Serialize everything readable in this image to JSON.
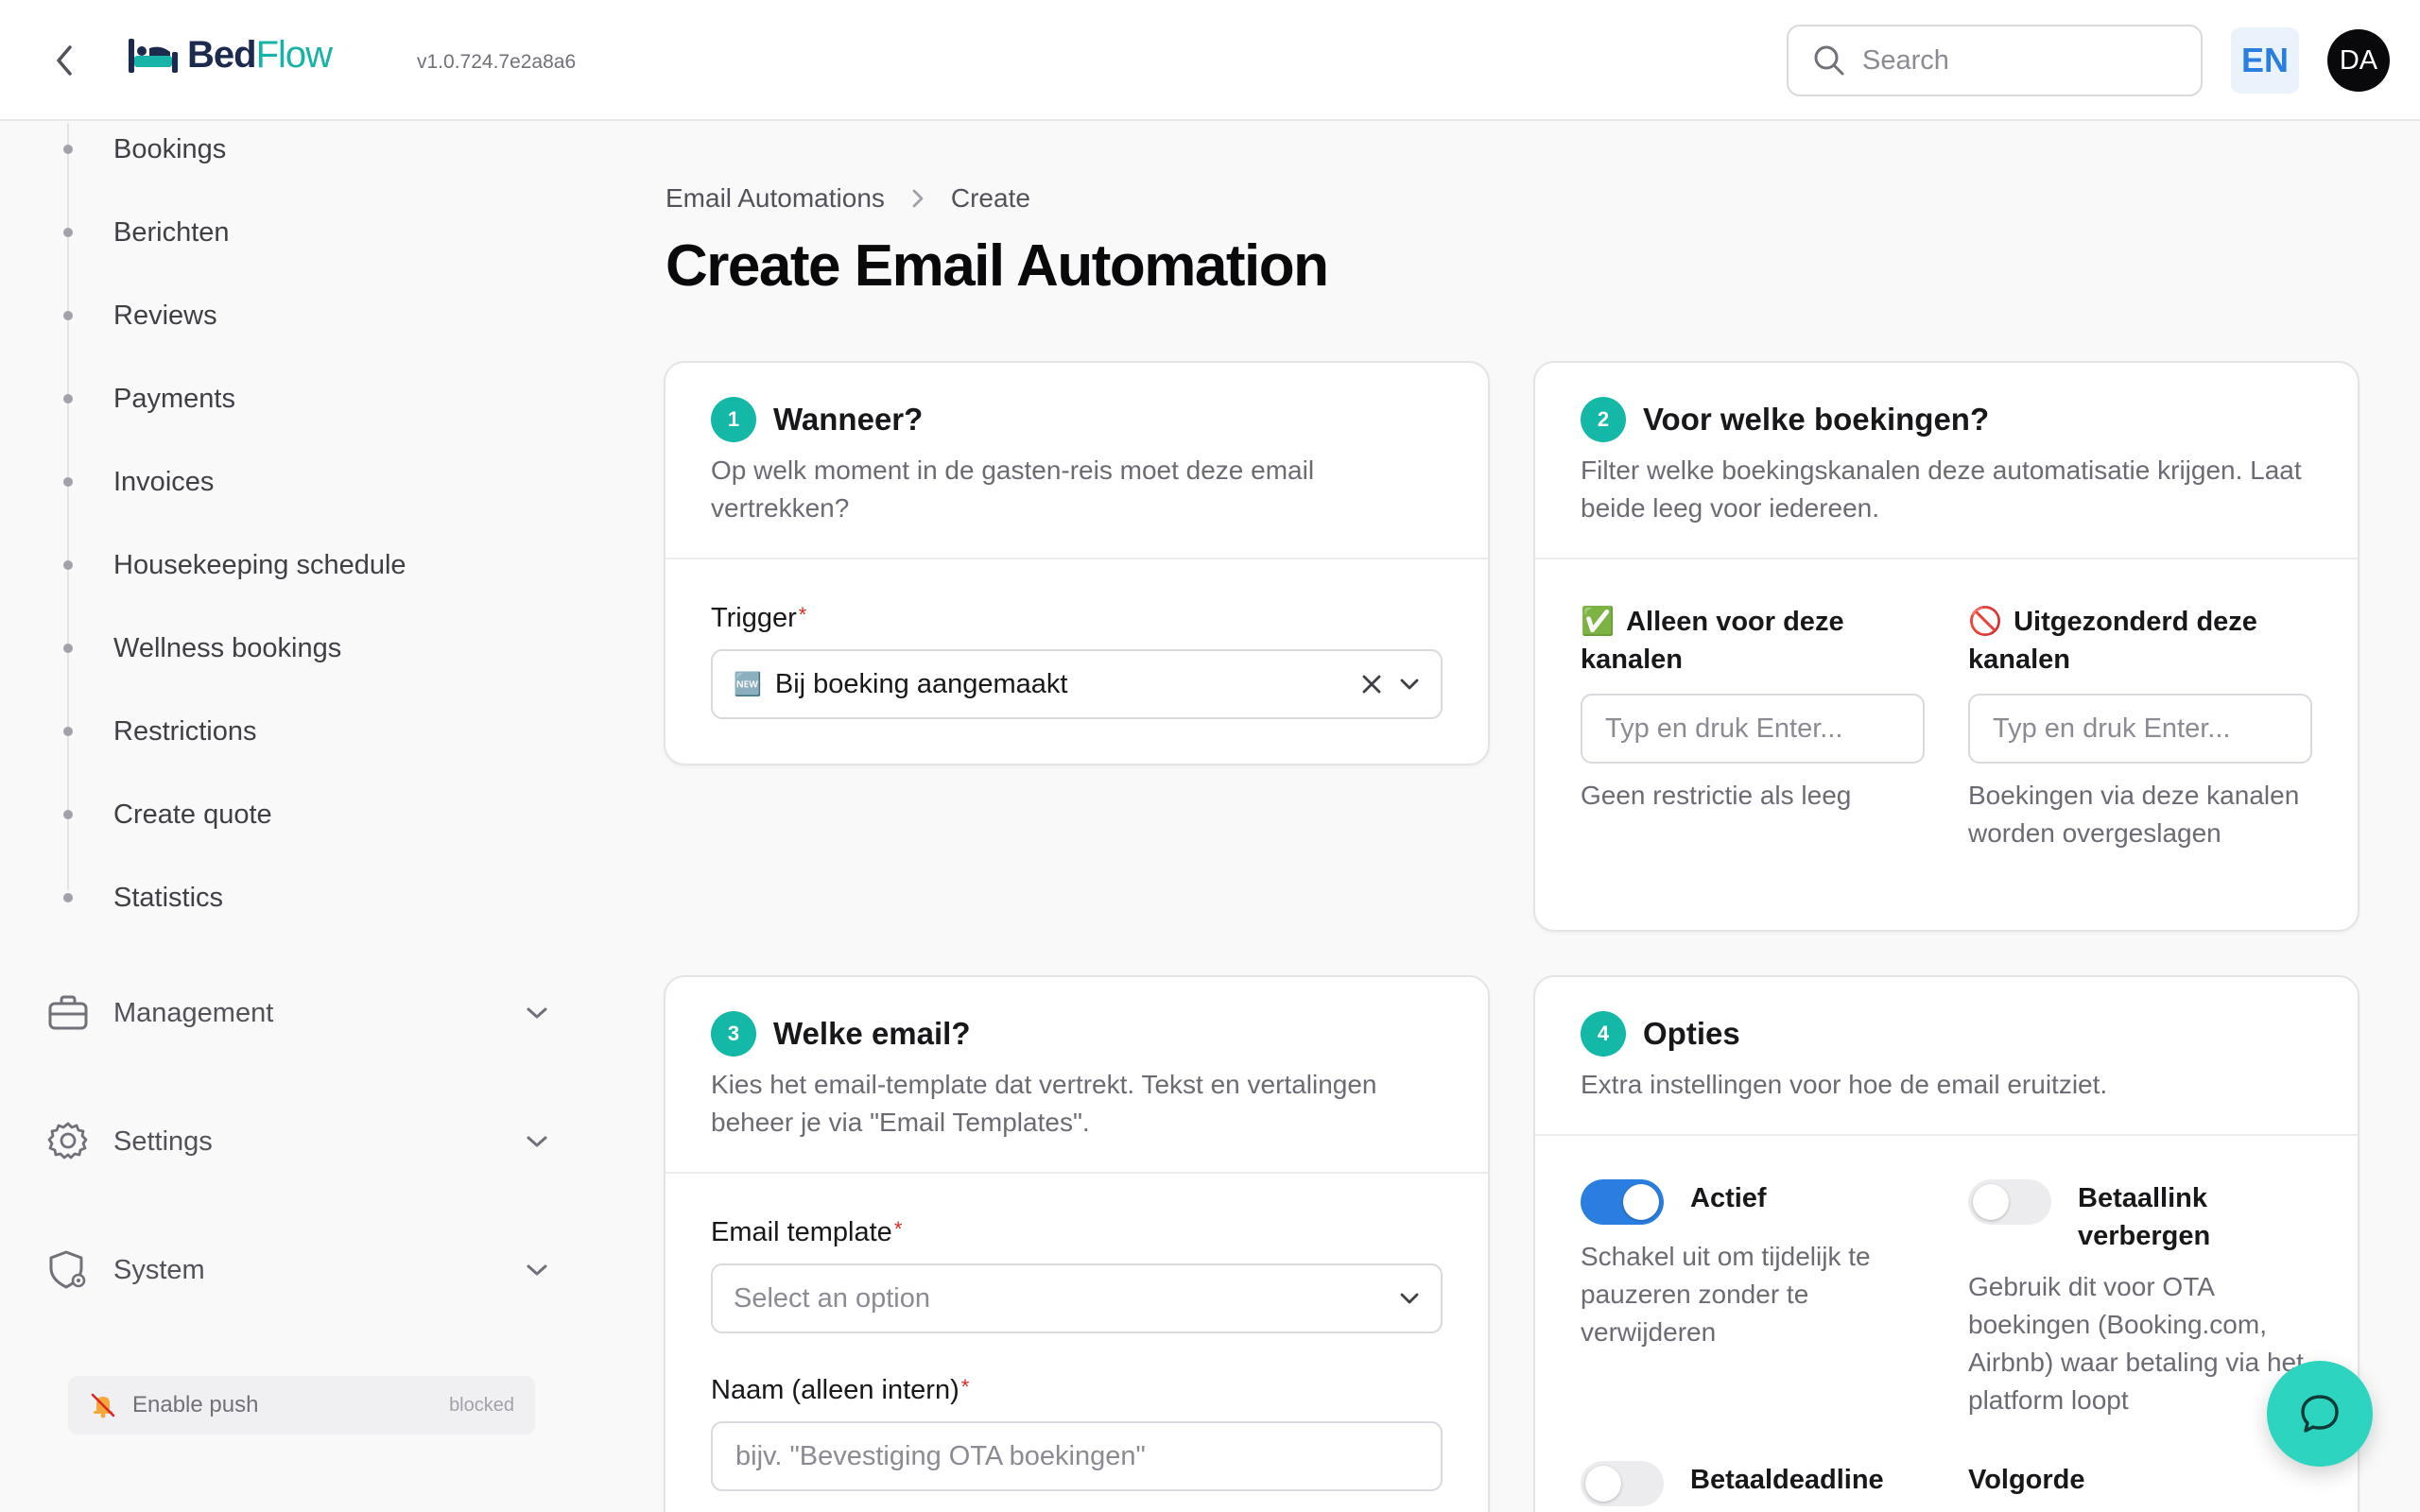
{
  "app": {
    "logo_part1": "Bed",
    "logo_part2": "Flow",
    "version": "v1.0.724.7e2a8a6"
  },
  "topbar": {
    "search_placeholder": "Search",
    "language": "EN",
    "user_initials": "DA"
  },
  "sidebar": {
    "items": [
      {
        "label": "Bookings"
      },
      {
        "label": "Berichten"
      },
      {
        "label": "Reviews"
      },
      {
        "label": "Payments"
      },
      {
        "label": "Invoices"
      },
      {
        "label": "Housekeeping schedule"
      },
      {
        "label": "Wellness bookings"
      },
      {
        "label": "Restrictions"
      },
      {
        "label": "Create quote"
      },
      {
        "label": "Statistics"
      }
    ],
    "groups": [
      {
        "label": "Management",
        "icon": "briefcase-icon"
      },
      {
        "label": "Settings",
        "icon": "gear-icon"
      },
      {
        "label": "System",
        "icon": "shield-gear-icon"
      }
    ],
    "push": {
      "label": "Enable push",
      "state": "blocked"
    }
  },
  "breadcrumb": {
    "parent": "Email Automations",
    "current": "Create"
  },
  "page_title": "Create Email Automation",
  "cards": {
    "when": {
      "step": "1",
      "title": "Wanneer?",
      "description": "Op welk moment in de gasten-reis moet deze email vertrekken?",
      "trigger_label": "Trigger",
      "required_mark": "*",
      "trigger_value": "Bij boeking aangemaakt",
      "trigger_emoji": "🆕"
    },
    "bookings": {
      "step": "2",
      "title": "Voor welke boekingen?",
      "description": "Filter welke boekingskanalen deze automatisatie krijgen. Laat beide leeg voor iedereen.",
      "include_label": "Alleen voor deze kanalen",
      "include_emoji": "✅",
      "include_placeholder": "Typ en druk Enter...",
      "include_hint": "Geen restrictie als leeg",
      "exclude_label": "Uitgezonderd deze kanalen",
      "exclude_emoji": "🚫",
      "exclude_placeholder": "Typ en druk Enter...",
      "exclude_hint": "Boekingen via deze kanalen worden overgeslagen"
    },
    "email": {
      "step": "3",
      "title": "Welke email?",
      "description": "Kies het email-template dat vertrekt. Tekst en vertalingen beheer je via \"Email Templates\".",
      "template_label": "Email template",
      "required_mark": "*",
      "template_placeholder": "Select an option",
      "name_label": "Naam (alleen intern)",
      "name_placeholder": "bijv. \"Bevestiging OTA boekingen\""
    },
    "options": {
      "step": "4",
      "title": "Opties",
      "description": "Extra instellingen voor hoe de email eruitziet.",
      "active_label": "Actief",
      "active_on": true,
      "active_hint": "Schakel uit om tijdelijk te pauzeren zonder te verwijderen",
      "hide_paylink_label": "Betaallink verbergen",
      "hide_paylink_on": false,
      "hide_paylink_hint": "Gebruik dit voor OTA boekingen (Booking.com, Airbnb) waar betaling via het platform loopt",
      "deadline_label": "Betaaldeadline",
      "deadline_on": false,
      "order_label": "Volgorde"
    }
  },
  "colors": {
    "accent_teal": "#14b8a6",
    "toggle_blue": "#2a7de1",
    "required_red": "#dc2626",
    "chat_fab": "#2dd4bf"
  }
}
